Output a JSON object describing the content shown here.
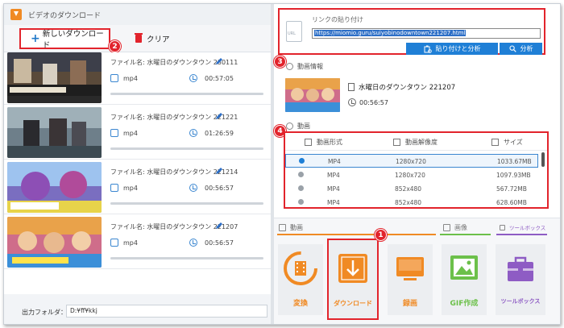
{
  "app": {
    "title": "ビデオのダウンロード"
  },
  "toolbar": {
    "new_download": "新しいダウンロード",
    "clear": "クリア"
  },
  "badges": [
    "1",
    "2",
    "3",
    "4"
  ],
  "downloads": [
    {
      "filename": "ファイル名: 水曜日のダウンタウン 230111",
      "format": "mp4",
      "duration": "00:57:05"
    },
    {
      "filename": "ファイル名: 水曜日のダウンタウン 221221",
      "format": "mp4",
      "duration": "01:26:59"
    },
    {
      "filename": "ファイル名: 水曜日のダウンタウン 221214",
      "format": "mp4",
      "duration": "00:56:57"
    },
    {
      "filename": "ファイル名: 水曜日のダウンタウン 221207",
      "format": "mp4",
      "duration": "00:56:57"
    }
  ],
  "output": {
    "label": "出力フォルダ：",
    "path": "D:¥ff¥kkj"
  },
  "link": {
    "label": "リンクの貼り付け",
    "url": "https://miomio.guru/suiyobinodowntown221207.html",
    "paste_analyze": "貼り付けと分析",
    "analyze": "分析"
  },
  "video_info": {
    "section": "動画情報",
    "title": "水曜日のダウンタウン 221207",
    "duration": "00:56:57"
  },
  "video_section": {
    "section": "動画",
    "headers": {
      "format": "動画形式",
      "resolution": "動画解像度",
      "size": "サイズ"
    },
    "rows": [
      {
        "format": "MP4",
        "resolution": "1280x720",
        "size": "1033.67MB",
        "selected": true
      },
      {
        "format": "MP4",
        "resolution": "1280x720",
        "size": "1097.93MB",
        "selected": false
      },
      {
        "format": "MP4",
        "resolution": "852x480",
        "size": "567.72MB",
        "selected": false
      },
      {
        "format": "MP4",
        "resolution": "852x480",
        "size": "628.60MB",
        "selected": false
      }
    ]
  },
  "tools": {
    "tab_video": "動画",
    "tab_image": "画像",
    "tab_toolbox": "ツールボックス",
    "convert": "変換",
    "download": "ダウンロード",
    "record": "録画",
    "gif": "GIF作成",
    "toolbox": "ツールボックス"
  },
  "colors": {
    "accent_red": "#e2242c",
    "blue": "#1f7fd6",
    "orange": "#f08a24",
    "green": "#6cc04a",
    "purple": "#8e5cc4"
  }
}
